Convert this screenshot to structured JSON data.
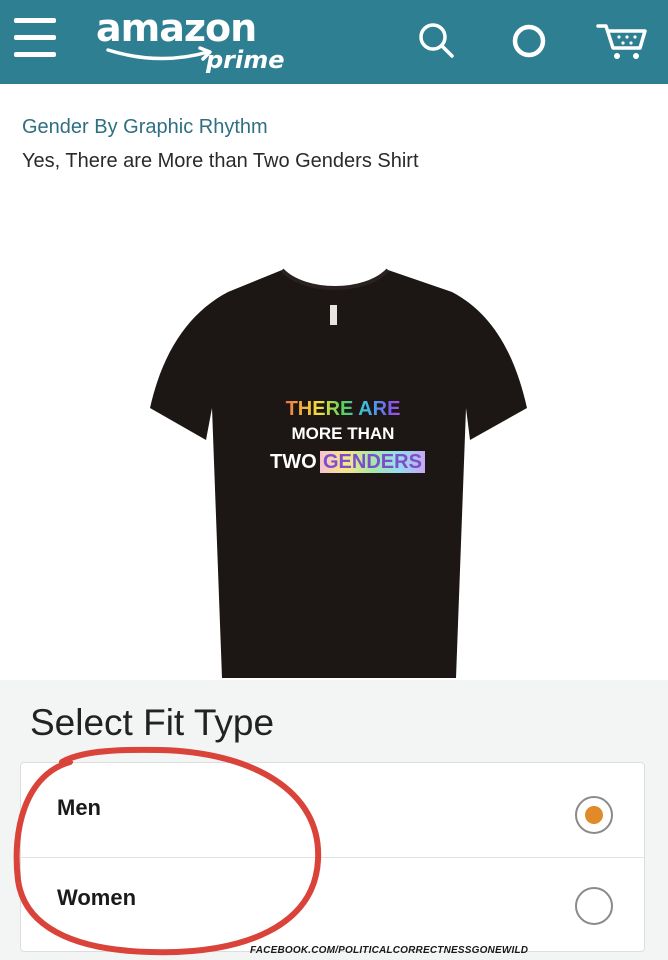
{
  "header": {
    "logo_word": "amazon",
    "logo_sub": "prime",
    "icons": [
      "menu-icon",
      "search-icon",
      "alexa-icon",
      "cart-icon"
    ],
    "bar_color": "#2f7f92"
  },
  "product": {
    "brand": "Gender By Graphic Rhythm",
    "title": "Yes, There are More than Two Genders Shirt",
    "shirt_text": {
      "line1": "THERE ARE",
      "line2": "MORE THAN",
      "line3_a": "TWO",
      "line3_b": "GENDERS"
    }
  },
  "fit": {
    "label": "Select Fit Type",
    "options": [
      {
        "label": "Men",
        "selected": true
      },
      {
        "label": "Women",
        "selected": false
      }
    ],
    "selected_color": "#e08a2a"
  },
  "annotation_color": "#d9433a",
  "watermark": "FACEBOOK.COM/POLITICALCORRECTNESSGONEWILD"
}
